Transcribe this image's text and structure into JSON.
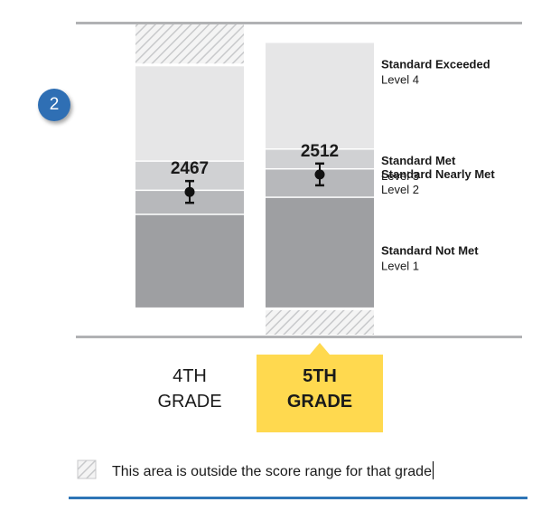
{
  "step": {
    "number": "2"
  },
  "chart_data": {
    "type": "bar",
    "scale": {
      "min": 2100,
      "max": 2900
    },
    "levels": [
      {
        "name": "Standard Exceeded",
        "level": "Level 4"
      },
      {
        "name": "Standard Met",
        "level": "Level 3"
      },
      {
        "name": "Standard Nearly Met",
        "level": "Level 2"
      },
      {
        "name": "Standard Not Met",
        "level": "Level 1"
      }
    ],
    "grades": [
      {
        "label_line1": "4th",
        "label_line2": "Grade",
        "selected": false,
        "score": 2467,
        "score_text": "2467",
        "error": 28,
        "range": [
          2170,
          2790
        ],
        "cuts": [
          2411,
          2473,
          2548
        ],
        "outside_low": 0,
        "outside_high": 1
      },
      {
        "label_line1": "5th",
        "label_line2": "Grade",
        "selected": true,
        "score": 2512,
        "score_text": "2512",
        "error": 28,
        "range": [
          2170,
          2850
        ],
        "cuts": [
          2455,
          2528,
          2579
        ],
        "outside_low": 1,
        "outside_high": 0
      }
    ],
    "colors": {
      "level1": "#9e9fa2",
      "level2": "#b7b8bb",
      "level3": "#d0d1d3",
      "level4": "#e6e6e7",
      "selected_bg": "#ffd94f",
      "axis": "#b1b2b4",
      "footer_line": "#2e75b6",
      "badge": "#2f6fb4"
    }
  },
  "legend": {
    "outside_text": "This area is outside the score range for that grade"
  }
}
